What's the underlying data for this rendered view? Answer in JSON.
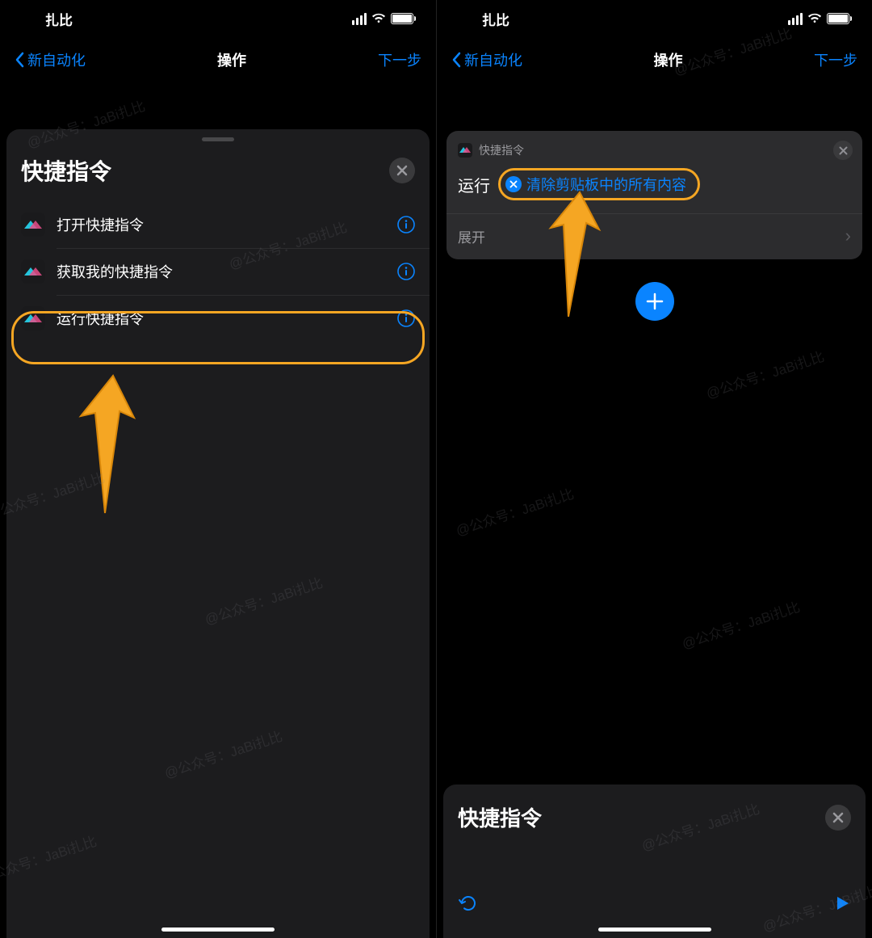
{
  "status": {
    "carrier": "扎比"
  },
  "nav": {
    "back": "新自动化",
    "title": "操作",
    "next": "下一步"
  },
  "left": {
    "sheet_title": "快捷指令",
    "rows": [
      {
        "label": "打开快捷指令"
      },
      {
        "label": "获取我的快捷指令"
      },
      {
        "label": "运行快捷指令"
      }
    ]
  },
  "right": {
    "card": {
      "app": "快捷指令",
      "run_prefix": "运行",
      "token": "清除剪贴板中的所有内容",
      "expand": "展开"
    },
    "mini_sheet_title": "快捷指令"
  },
  "watermark": "@公众号：JaBi扎比",
  "colors": {
    "accent": "#0a84ff",
    "highlight": "#f5a623"
  }
}
